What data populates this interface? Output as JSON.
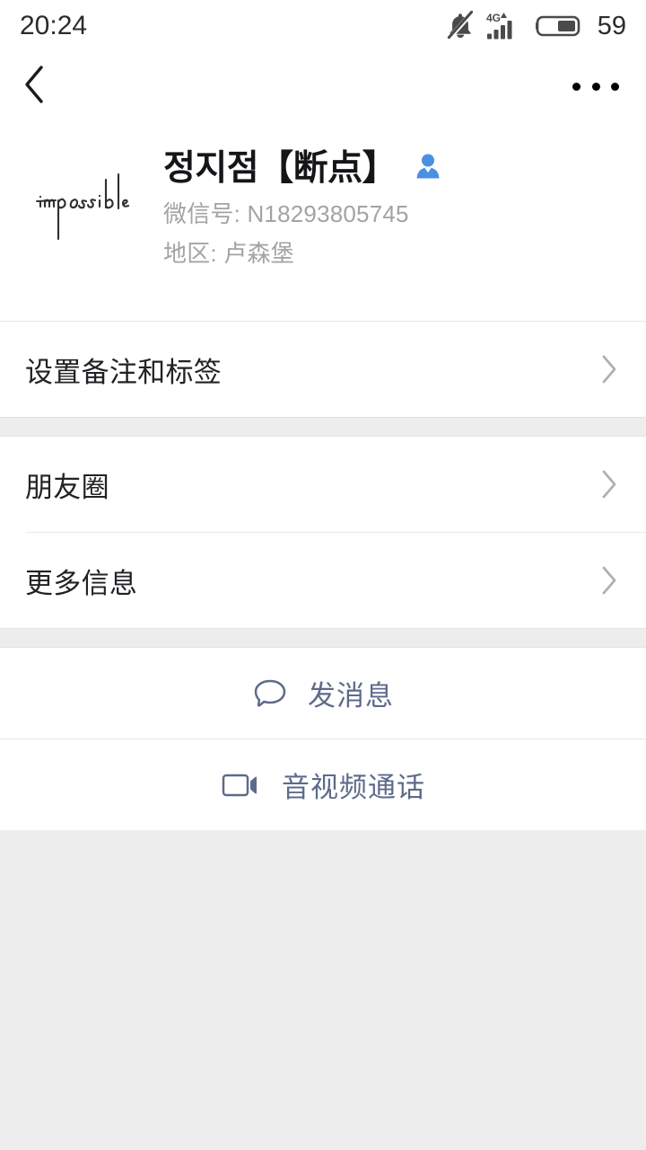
{
  "status_bar": {
    "time": "20:24",
    "battery_percent": "59",
    "network": "4G",
    "icons": [
      "mute-bell-icon",
      "signal-4g-icon",
      "battery-icon"
    ]
  },
  "nav": {
    "back_icon": "chevron-left-icon",
    "more_icon": "more-options-icon"
  },
  "profile": {
    "avatar_alt": "impossible",
    "name": "정지점【断点】",
    "gender_icon": "male-person-icon",
    "wechat_id_label": "微信号: N18293805745",
    "region_label": "地区: 卢森堡"
  },
  "sections": [
    {
      "rows": [
        {
          "label": "设置备注和标签",
          "chevron": "chevron-right-icon"
        }
      ]
    },
    {
      "rows": [
        {
          "label": "朋友圈",
          "chevron": "chevron-right-icon"
        },
        {
          "label": "更多信息",
          "chevron": "chevron-right-icon"
        }
      ]
    }
  ],
  "actions": [
    {
      "label": "发消息",
      "icon": "message-bubble-icon"
    },
    {
      "label": "音视频通话",
      "icon": "video-camera-icon"
    }
  ],
  "colors": {
    "accent_blue": "#4a90e2",
    "action_blue": "#5d6b8a",
    "page_bg": "#ededed",
    "card_bg": "#ffffff",
    "primary_text": "#222226",
    "secondary_text": "#a3a3a3"
  }
}
